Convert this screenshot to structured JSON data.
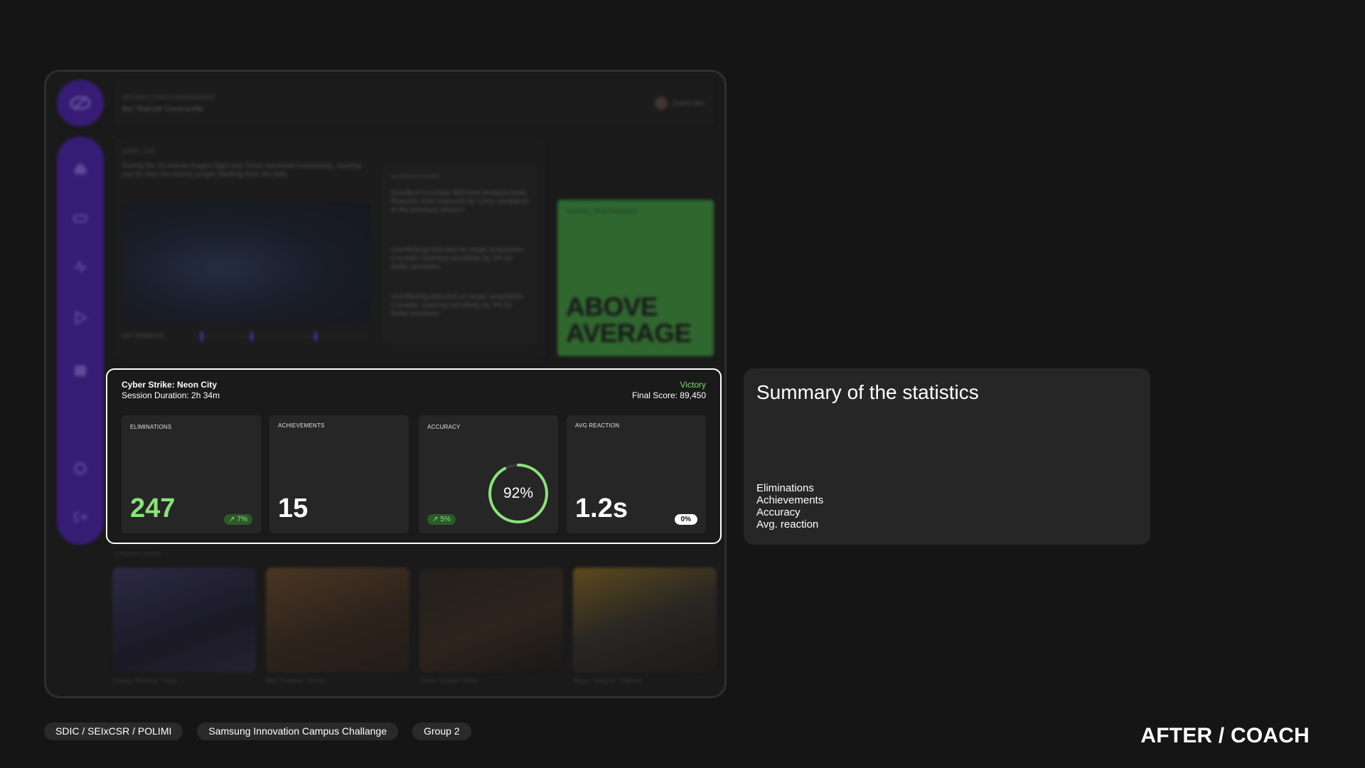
{
  "app": {
    "header_label": "SPLASH COACH DASHBOARD",
    "header_sub": "Bex \"Ryecroft\" Camel profile",
    "user_name": "Coach Alex"
  },
  "game_panel": {
    "tag": "GAME / 1/10",
    "description": "During the 25-minute dragon fight your focus narrowed excessively, causing you to miss the enemy jungler flanking from the side.",
    "timeline_label": "KEY MOMENTS"
  },
  "insights": {
    "header": "AI SUGGESTIONS",
    "items": [
      "Excellent crosshair flick-time Analysis peak. Reaction time improved by 12ms compared to the previous session.",
      "Overflicking detected on target acquisition. Consider lowering sensitivity by 3% for better precision.",
      "Overflicking detected on target acquisition. Consider lowering sensitivity by 3% for better precision."
    ]
  },
  "performance": {
    "header": "OVERALL PERFORMANCE",
    "line1": "ABOVE",
    "line2": "AVERAGE",
    "color": "#3f9b3d"
  },
  "session": {
    "title": "Cyber Strike: Neon City",
    "duration": "Session Duration: 2h 34m",
    "result": "Victory",
    "final_score": "Final Score: 89,450",
    "stats": {
      "eliminations": {
        "label": "ELIMINATIONS",
        "value": "247",
        "change": "7%"
      },
      "achievements": {
        "label": "ACHIEVEMENTS",
        "value": "15"
      },
      "accuracy": {
        "label": "ACCURACY",
        "value": "92%",
        "fraction": 0.92,
        "change": "5%"
      },
      "avg_reaction": {
        "label": "AVG REACTION",
        "value": "1.2s",
        "change": "0%"
      }
    }
  },
  "players": {
    "tag": "OTHER PLAYERS",
    "items": [
      {
        "name": "Chang \"Phoenix\" Yong"
      },
      {
        "name": "Mai \"Phoenix\" Tomas"
      },
      {
        "name": "Chloe \"Ember\" Reed"
      },
      {
        "name": "Maya \"Valkyrie\" Sharma"
      }
    ]
  },
  "summary": {
    "title": "Summary of the statistics",
    "items": [
      "Eliminations",
      "Achievements",
      "Accuracy",
      "Avg. reaction"
    ]
  },
  "footer": {
    "chips": [
      "SDIC / SEIxCSR / POLIMI",
      "Samsung Innovation Campus Challange",
      "Group 2"
    ],
    "label": "AFTER / COACH"
  },
  "colors": {
    "accent_purple": "#4c1fb3",
    "victory_green": "#7ddc6c",
    "stat_green": "#8ae27a"
  },
  "icons": {
    "logo": "eye-slash-logo-icon",
    "sidebar": [
      "home-icon",
      "gamepad-icon",
      "activity-icon",
      "play-icon",
      "calendar-icon",
      "settings-icon",
      "logout-icon"
    ]
  }
}
